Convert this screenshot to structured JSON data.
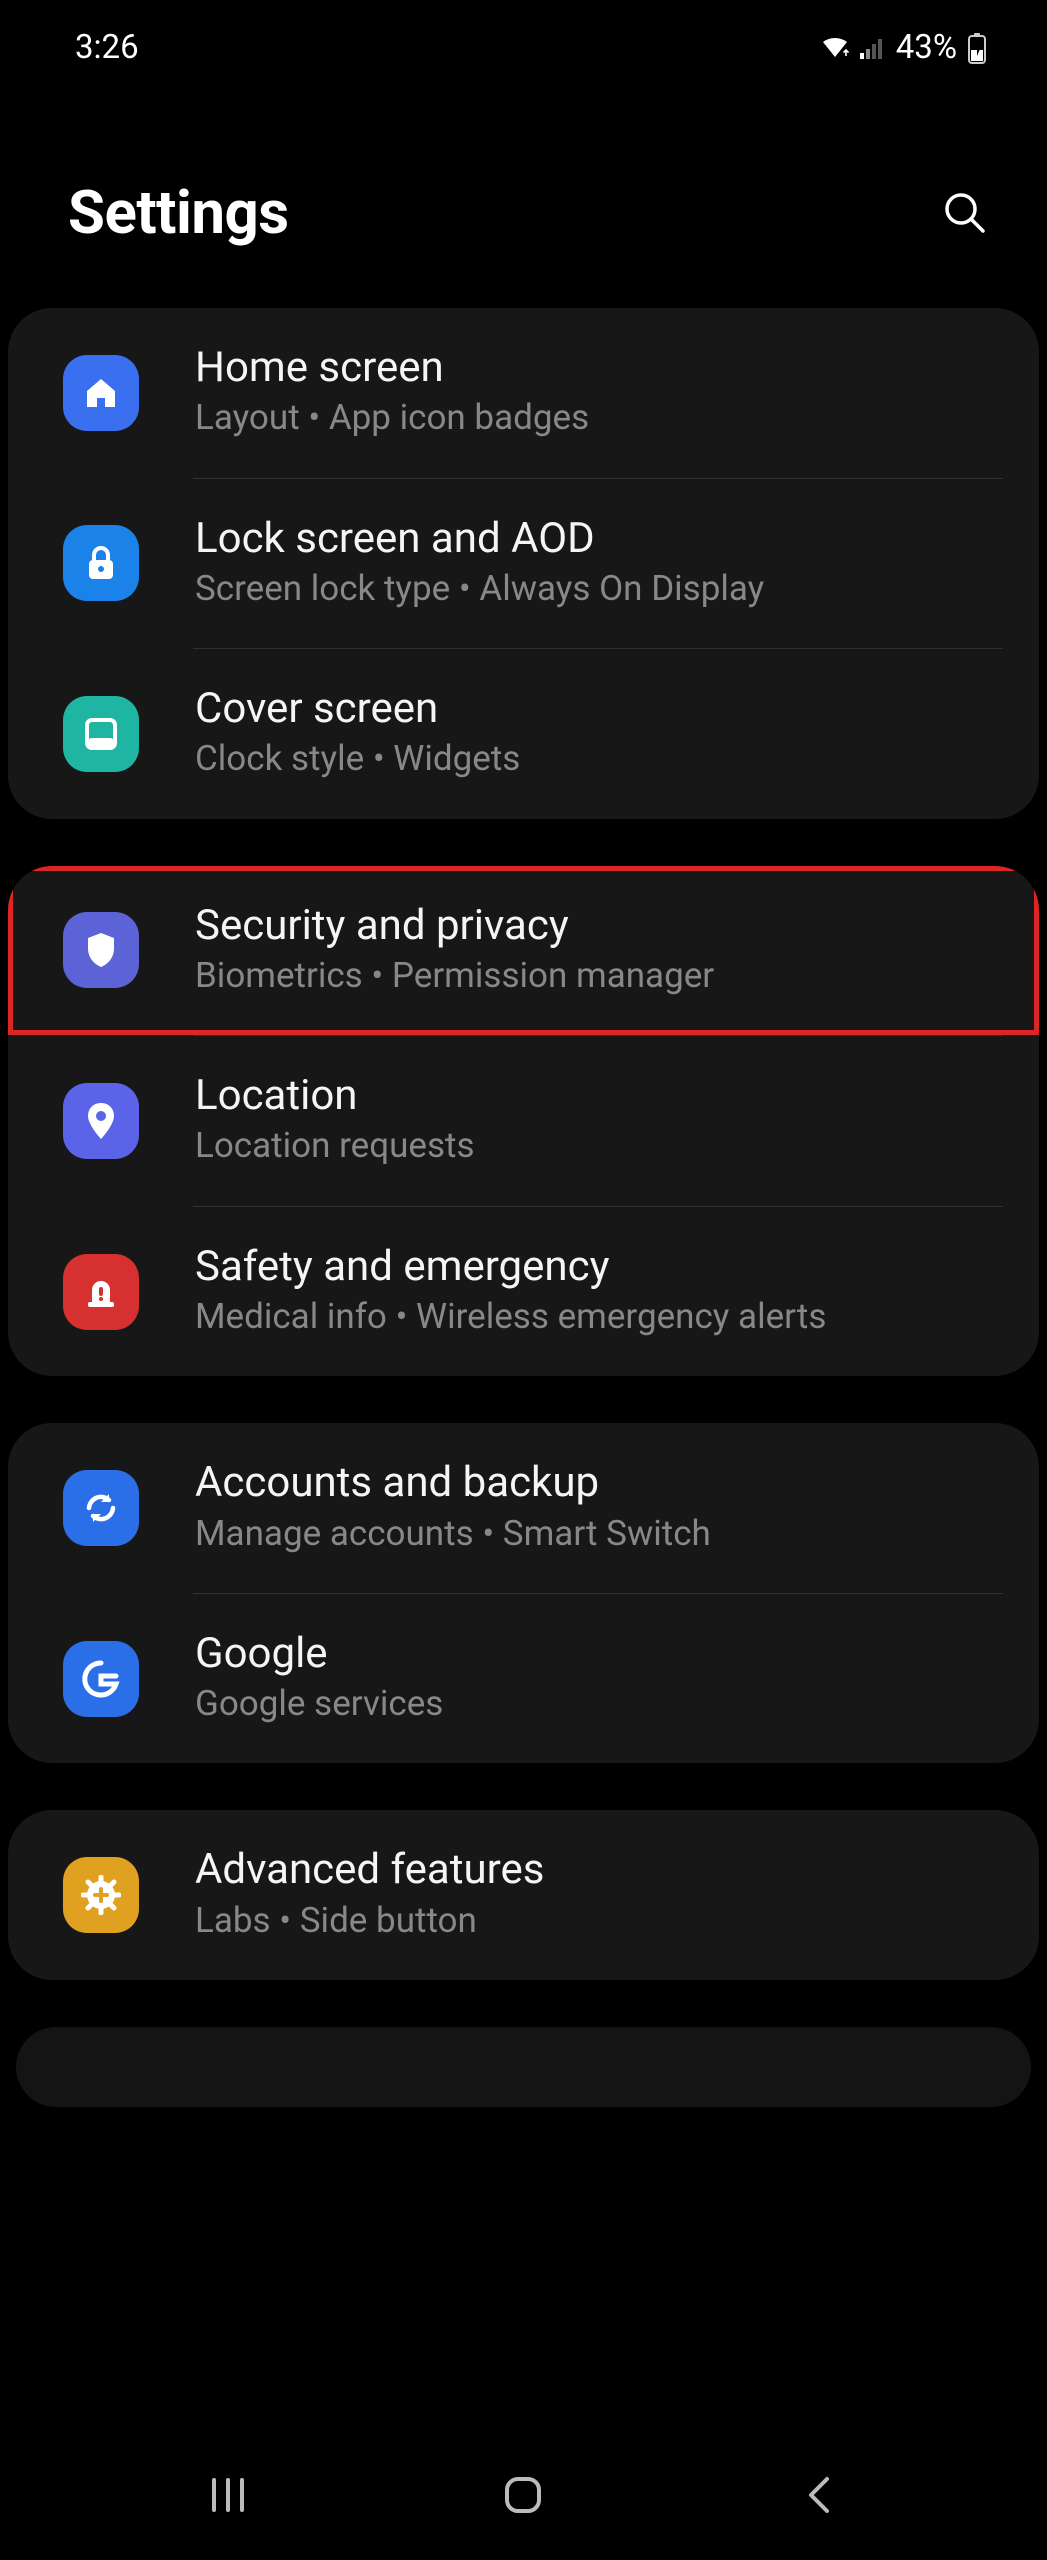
{
  "status": {
    "time": "3:26",
    "battery": "43%"
  },
  "header": {
    "title": "Settings"
  },
  "groups": [
    {
      "items": [
        {
          "id": "home-screen",
          "title": "Home screen",
          "sub": "Layout  •  App icon badges",
          "iconBg": "#3a6ff0",
          "highlighted": false
        },
        {
          "id": "lock-screen",
          "title": "Lock screen and AOD",
          "sub": "Screen lock type  •  Always On Display",
          "iconBg": "#1a82e8",
          "highlighted": false
        },
        {
          "id": "cover-screen",
          "title": "Cover screen",
          "sub": "Clock style  •  Widgets",
          "iconBg": "#1fb5a3",
          "highlighted": false
        }
      ]
    },
    {
      "items": [
        {
          "id": "security-privacy",
          "title": "Security and privacy",
          "sub": "Biometrics  •  Permission manager",
          "iconBg": "#5b63d6",
          "highlighted": true
        },
        {
          "id": "location",
          "title": "Location",
          "sub": "Location requests",
          "iconBg": "#5b63e8",
          "highlighted": false
        },
        {
          "id": "safety-emergency",
          "title": "Safety and emergency",
          "sub": "Medical info  •  Wireless emergency alerts",
          "iconBg": "#d63030",
          "highlighted": false
        }
      ]
    },
    {
      "items": [
        {
          "id": "accounts-backup",
          "title": "Accounts and backup",
          "sub": "Manage accounts  •  Smart Switch",
          "iconBg": "#2a6fe8",
          "highlighted": false
        },
        {
          "id": "google",
          "title": "Google",
          "sub": "Google services",
          "iconBg": "#2a6fe8",
          "highlighted": false
        }
      ]
    },
    {
      "items": [
        {
          "id": "advanced-features",
          "title": "Advanced features",
          "sub": "Labs  •  Side button",
          "iconBg": "#e0a020",
          "highlighted": false
        }
      ]
    }
  ],
  "icons": {
    "home-screen": "home",
    "lock-screen": "lock",
    "cover-screen": "cover",
    "security-privacy": "shield",
    "location": "pin",
    "safety-emergency": "siren",
    "accounts-backup": "sync",
    "google": "google",
    "advanced-features": "gear-plus"
  }
}
